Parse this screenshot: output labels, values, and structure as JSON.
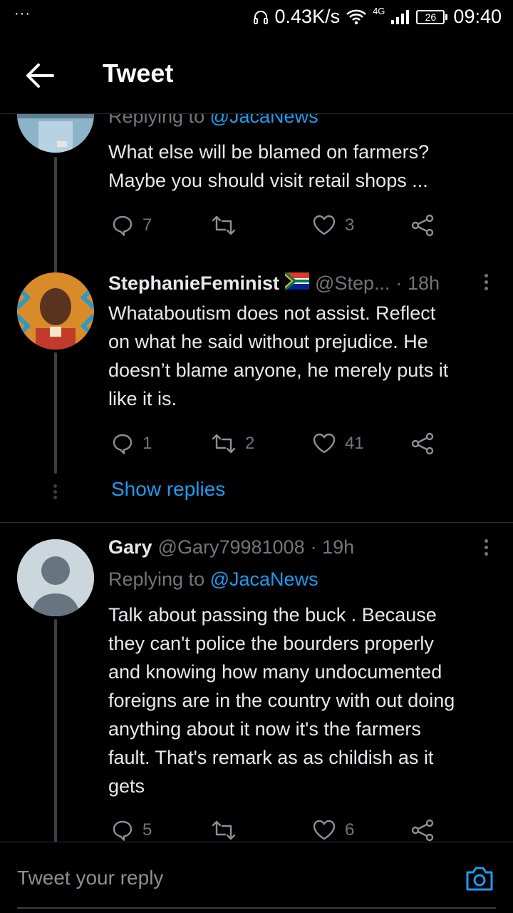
{
  "statusbar": {
    "speed": "0.43K/s",
    "network": "4G",
    "battery": "26",
    "time": "09:40",
    "dots": "···"
  },
  "header": {
    "title": "Tweet",
    "back_icon": "arrow-left-icon"
  },
  "tweets": [
    {
      "replying_prefix": "Replying to",
      "replying_handle": "@JacaNews",
      "lines": [
        "What else will be blamed on farmers?",
        "Maybe you should visit retail shops ..."
      ],
      "reply_count": "7",
      "retweet_count": "",
      "like_count": "3"
    },
    {
      "name": "StephanieFeminist",
      "flag": "south-africa-flag",
      "handle": "@Step...",
      "time": "· 18h",
      "lines": [
        "Whataboutism does not assist. Reflect",
        "on what he said without prejudice. He",
        "doesn’t blame anyone, he merely puts it",
        "like it is."
      ],
      "reply_count": "1",
      "retweet_count": "2",
      "like_count": "41",
      "show_replies": "Show replies"
    },
    {
      "name": "Gary",
      "handle": "@Gary79981008",
      "time": "· 19h",
      "replying_prefix": "Replying to",
      "replying_handle": "@JacaNews",
      "lines": [
        "Talk about passing the buck  . Because",
        "they can't police the bourders properly",
        "and knowing how many undocumented",
        "foreigns are in the country with out doing",
        "anything about it now it's the farmers",
        "fault. That's remark as as childish as it",
        "gets"
      ],
      "reply_count": "5",
      "retweet_count": "",
      "like_count": "6"
    }
  ],
  "reply_bar": {
    "placeholder": "Tweet your reply",
    "camera_icon": "camera-icon"
  },
  "colors": {
    "background": "#000000",
    "link": "#1d9bf0",
    "muted": "#71767b",
    "text": "#e7e9ea"
  }
}
